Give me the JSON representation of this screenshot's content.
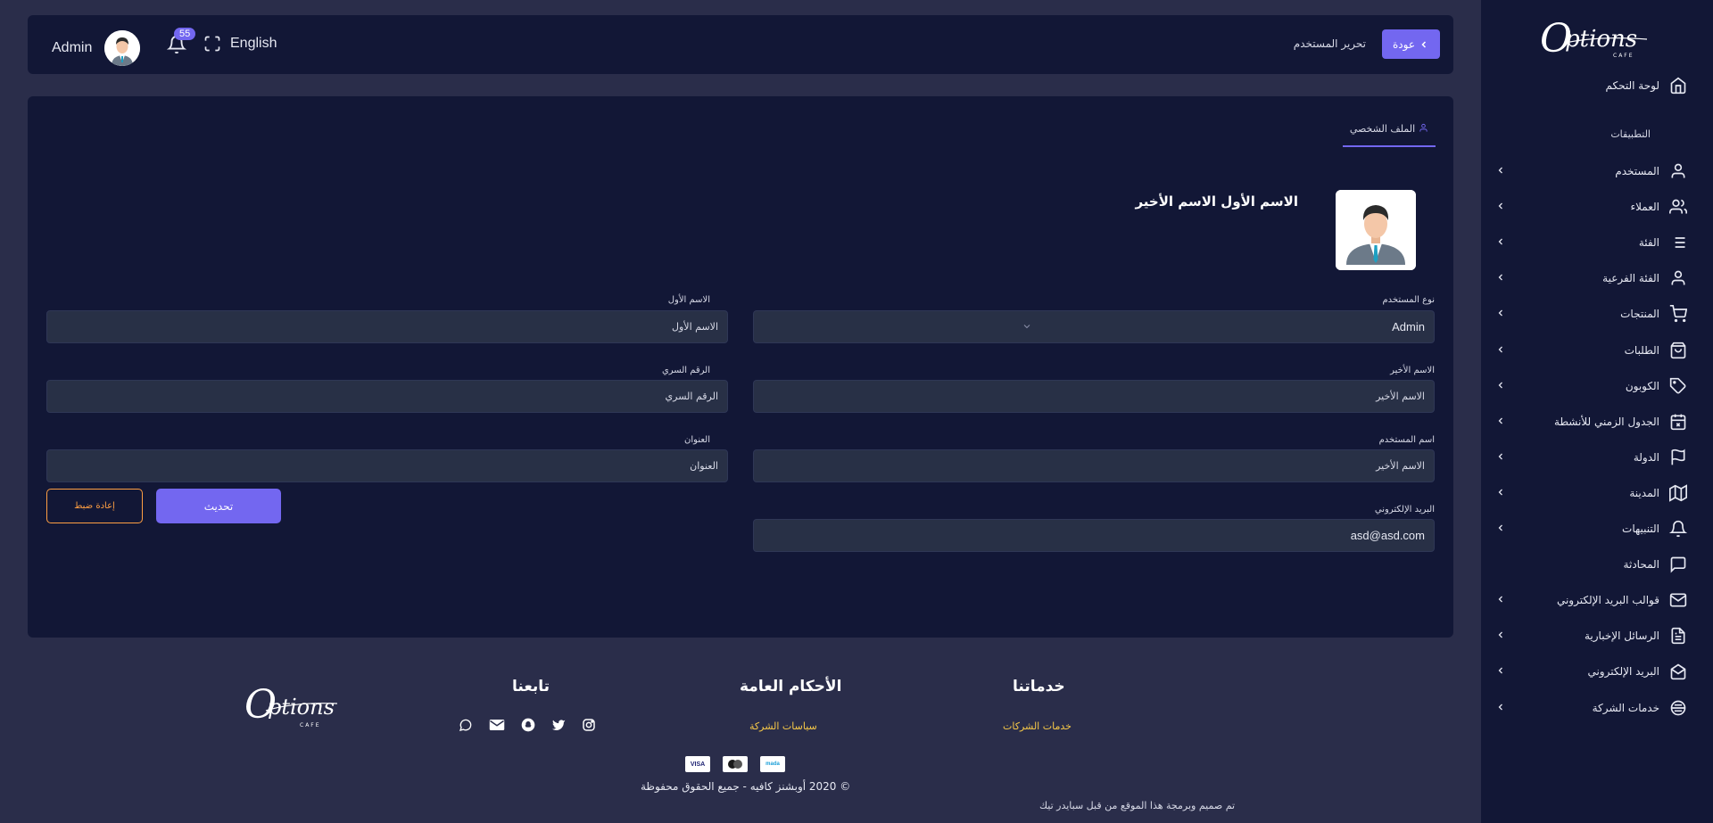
{
  "topbar": {
    "user_name": "Admin",
    "notification_count": "55",
    "language": "English",
    "back_label": "عودة",
    "page_title": "تحرير المستخدم"
  },
  "profile": {
    "tab_label": "الملف الشخصي",
    "full_name": "الاسم الأول الاسم الأخير"
  },
  "form": {
    "user_type": {
      "label": "نوع المستخدم",
      "value": "Admin"
    },
    "first_name": {
      "label": "الاسم الأول",
      "value": "الاسم الأول"
    },
    "last_name": {
      "label": "الاسم الأخير",
      "value": "الاسم الأخير"
    },
    "password": {
      "label": "الرقم السري",
      "value": "الرقم السري"
    },
    "username": {
      "label": "اسم المستخدم",
      "value": "الاسم الأخير"
    },
    "address": {
      "label": "العنوان",
      "value": "العنوان"
    },
    "email": {
      "label": "البريد الإلكتروني",
      "value": "asd@asd.com"
    },
    "update_label": "تحديث",
    "reset_label": "إعادة ضبط"
  },
  "footer": {
    "services_heading": "خدماتنا",
    "services_link": "خدمات الشركات",
    "terms_heading": "الأحكام العامة",
    "terms_link": "سياسات الشركة",
    "follow_heading": "تابعنا",
    "payment": [
      "VISA",
      "mastercard",
      "mada"
    ],
    "copyright": "© 2020 أوبشنز كافيه - جميع الحقوق محفوظة",
    "designed_by": "تم صميم وبرمجة هذا الموقع من قبل سبايدر تيك"
  },
  "logo": {
    "main": "Options",
    "sub": "CAFE"
  },
  "sidebar": {
    "dashboard": "لوحة التحكم",
    "section_label": "التطبيقات",
    "items": [
      {
        "label": "المستخدم",
        "icon": "user-icon",
        "chevron": true
      },
      {
        "label": "العملاء",
        "icon": "users-icon",
        "chevron": true
      },
      {
        "label": "الفئة",
        "icon": "list-icon",
        "chevron": true
      },
      {
        "label": "الفئة الفرعية",
        "icon": "user-icon",
        "chevron": true
      },
      {
        "label": "المنتجات",
        "icon": "cart-icon",
        "chevron": true
      },
      {
        "label": "الطلبات",
        "icon": "bag-icon",
        "chevron": true
      },
      {
        "label": "الكوبون",
        "icon": "tag-icon",
        "chevron": true
      },
      {
        "label": "الجدول الزمني للأنشطة",
        "icon": "calendar-x-icon",
        "chevron": true
      },
      {
        "label": "الدولة",
        "icon": "flag-icon",
        "chevron": true
      },
      {
        "label": "المدينة",
        "icon": "map-icon",
        "chevron": true
      },
      {
        "label": "التنبيهات",
        "icon": "bell-icon",
        "chevron": true
      },
      {
        "label": "المحادثة",
        "icon": "chat-icon",
        "chevron": false
      },
      {
        "label": "قوالب البريد الإلكتروني",
        "icon": "mail-icon",
        "chevron": true
      },
      {
        "label": "الرسائل الإخبارية",
        "icon": "file-text-icon",
        "chevron": true
      },
      {
        "label": "البريد الإلكتروني",
        "icon": "mail-open-icon",
        "chevron": true
      },
      {
        "label": "خدمات الشركة",
        "icon": "service-icon",
        "chevron": true
      }
    ]
  },
  "colors": {
    "accent": "#7367f0",
    "warning": "#ff9f43",
    "link": "#f7c948"
  }
}
